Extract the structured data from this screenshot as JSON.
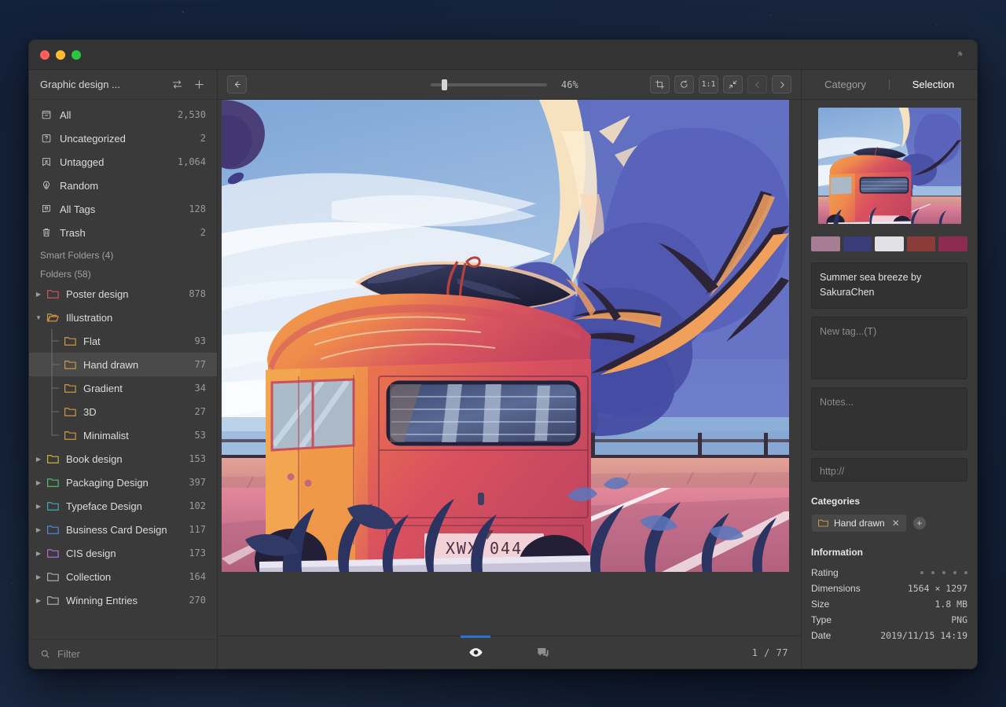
{
  "desktop": {
    "background": "#15223a"
  },
  "window": {
    "traffic_lights": [
      "close",
      "minimize",
      "zoom"
    ],
    "pin_icon": "pin-icon"
  },
  "sidebar": {
    "title": "Graphic design ...",
    "header_icons": [
      "sort-icon",
      "add-icon"
    ],
    "nav_items": [
      {
        "icon": "all-box-icon",
        "label": "All",
        "count": "2,530"
      },
      {
        "icon": "uncategorized-icon",
        "label": "Uncategorized",
        "count": "2"
      },
      {
        "icon": "untagged-icon",
        "label": "Untagged",
        "count": "1,064"
      },
      {
        "icon": "random-bulb-icon",
        "label": "Random",
        "count": ""
      },
      {
        "icon": "all-tags-icon",
        "label": "All Tags",
        "count": "128"
      },
      {
        "icon": "trash-icon",
        "label": "Trash",
        "count": "2"
      }
    ],
    "smart_folders_label": "Smart Folders (4)",
    "folders_label": "Folders (58)",
    "folders": [
      {
        "label": "Poster design",
        "count": "878",
        "color": "#c5585c",
        "depth": 0,
        "expanded": false,
        "selected": false
      },
      {
        "label": "Illustration",
        "count": "",
        "color": "#d1973f",
        "depth": 0,
        "expanded": true,
        "selected": false
      },
      {
        "label": "Flat",
        "count": "93",
        "color": "#d1973f",
        "depth": 1,
        "expanded": null,
        "selected": false
      },
      {
        "label": "Hand drawn",
        "count": "77",
        "color": "#d1973f",
        "depth": 1,
        "expanded": null,
        "selected": true
      },
      {
        "label": "Gradient",
        "count": "34",
        "color": "#d1973f",
        "depth": 1,
        "expanded": null,
        "selected": false
      },
      {
        "label": "3D",
        "count": "27",
        "color": "#d1973f",
        "depth": 1,
        "expanded": null,
        "selected": false
      },
      {
        "label": "Minimalist",
        "count": "53",
        "color": "#d1973f",
        "depth": 1,
        "expanded": null,
        "selected": false
      },
      {
        "label": "Book design",
        "count": "153",
        "color": "#c9b13e",
        "depth": 0,
        "expanded": false,
        "selected": false
      },
      {
        "label": "Packaging Design",
        "count": "397",
        "color": "#4fbd6e",
        "depth": 0,
        "expanded": false,
        "selected": false
      },
      {
        "label": "Typeface Design",
        "count": "102",
        "color": "#3fa8b8",
        "depth": 0,
        "expanded": false,
        "selected": false
      },
      {
        "label": "Business Card Design",
        "count": "117",
        "color": "#4f86d6",
        "depth": 0,
        "expanded": false,
        "selected": false
      },
      {
        "label": "CIS design",
        "count": "173",
        "color": "#a86fd1",
        "depth": 0,
        "expanded": false,
        "selected": false
      },
      {
        "label": "Collection",
        "count": "164",
        "color": "#a9a9a9",
        "depth": 0,
        "expanded": false,
        "selected": false
      },
      {
        "label": "Winning Entries",
        "count": "270",
        "color": "#a9a9a9",
        "depth": 0,
        "expanded": false,
        "selected": false
      }
    ],
    "filter_placeholder": "Filter"
  },
  "toolbar": {
    "back_icon": "arrow-left-icon",
    "zoom_value": "46%",
    "zoom_slider_percent": 10,
    "buttons": [
      {
        "icon": "crop-icon",
        "label": ""
      },
      {
        "icon": "rotate-icon",
        "label": ""
      },
      {
        "icon": "actual-size-icon",
        "label": "1:1"
      },
      {
        "icon": "fit-screen-icon",
        "label": ""
      },
      {
        "icon": "prev-icon",
        "label": ""
      },
      {
        "icon": "next-icon",
        "label": ""
      }
    ]
  },
  "viewer_bottom": {
    "tabs": [
      {
        "icon": "eye-icon",
        "active": true
      },
      {
        "icon": "comment-icon",
        "active": false
      }
    ],
    "pager": "1 / 77"
  },
  "inspector": {
    "tabs": [
      {
        "label": "Category",
        "active": false
      },
      {
        "label": "Selection",
        "active": true
      }
    ],
    "thumbnail_name": "image-thumbnail",
    "palette": [
      "#a67d95",
      "#383c78",
      "#e1e1e6",
      "#8c3c38",
      "#8e2c4f"
    ],
    "title": "Summer sea breeze by SakuraChen",
    "tags_placeholder": "New tag...(T)",
    "notes_placeholder": "Notes...",
    "url_placeholder": "http://",
    "categories_label": "Categories",
    "categories": [
      {
        "label": "Hand drawn",
        "color": "#d1973f"
      }
    ],
    "add_category_label": "+",
    "information_label": "Information",
    "information": [
      {
        "key": "Rating",
        "value": "",
        "rating": 0,
        "max_rating": 5
      },
      {
        "key": "Dimensions",
        "value": "1564 × 1297"
      },
      {
        "key": "Size",
        "value": "1.8 MB"
      },
      {
        "key": "Type",
        "value": "PNG"
      },
      {
        "key": "Date",
        "value": "2019/11/15 14:19"
      }
    ]
  }
}
